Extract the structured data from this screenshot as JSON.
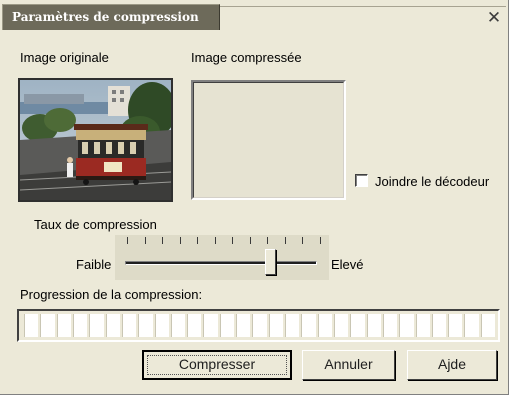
{
  "window": {
    "title": "Paramètres de compression"
  },
  "labels": {
    "original": "Image originale",
    "compressed": "Image compressée",
    "include_decoder": "Joindre le décodeur",
    "rate": "Taux de compression",
    "low": "Faible",
    "high": "Elevé",
    "progress": "Progression de la compression:"
  },
  "controls": {
    "include_decoder_checked": false,
    "compression_level_percent": 76,
    "progress_percent": 0
  },
  "buttons": {
    "compress": "Compresser",
    "cancel": "Annuler",
    "help": "Ajde"
  },
  "icons": {
    "close": "close-icon"
  }
}
